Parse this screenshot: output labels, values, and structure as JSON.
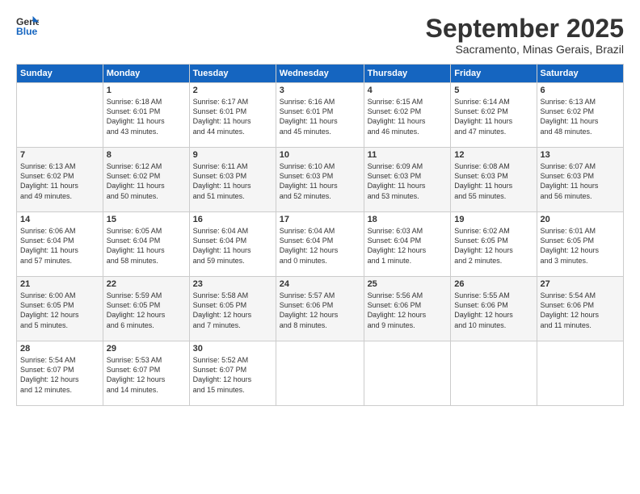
{
  "header": {
    "logo_line1": "General",
    "logo_line2": "Blue",
    "month": "September 2025",
    "location": "Sacramento, Minas Gerais, Brazil"
  },
  "days_of_week": [
    "Sunday",
    "Monday",
    "Tuesday",
    "Wednesday",
    "Thursday",
    "Friday",
    "Saturday"
  ],
  "weeks": [
    [
      {
        "num": "",
        "info": ""
      },
      {
        "num": "1",
        "info": "Sunrise: 6:18 AM\nSunset: 6:01 PM\nDaylight: 11 hours\nand 43 minutes."
      },
      {
        "num": "2",
        "info": "Sunrise: 6:17 AM\nSunset: 6:01 PM\nDaylight: 11 hours\nand 44 minutes."
      },
      {
        "num": "3",
        "info": "Sunrise: 6:16 AM\nSunset: 6:01 PM\nDaylight: 11 hours\nand 45 minutes."
      },
      {
        "num": "4",
        "info": "Sunrise: 6:15 AM\nSunset: 6:02 PM\nDaylight: 11 hours\nand 46 minutes."
      },
      {
        "num": "5",
        "info": "Sunrise: 6:14 AM\nSunset: 6:02 PM\nDaylight: 11 hours\nand 47 minutes."
      },
      {
        "num": "6",
        "info": "Sunrise: 6:13 AM\nSunset: 6:02 PM\nDaylight: 11 hours\nand 48 minutes."
      }
    ],
    [
      {
        "num": "7",
        "info": "Sunrise: 6:13 AM\nSunset: 6:02 PM\nDaylight: 11 hours\nand 49 minutes."
      },
      {
        "num": "8",
        "info": "Sunrise: 6:12 AM\nSunset: 6:02 PM\nDaylight: 11 hours\nand 50 minutes."
      },
      {
        "num": "9",
        "info": "Sunrise: 6:11 AM\nSunset: 6:03 PM\nDaylight: 11 hours\nand 51 minutes."
      },
      {
        "num": "10",
        "info": "Sunrise: 6:10 AM\nSunset: 6:03 PM\nDaylight: 11 hours\nand 52 minutes."
      },
      {
        "num": "11",
        "info": "Sunrise: 6:09 AM\nSunset: 6:03 PM\nDaylight: 11 hours\nand 53 minutes."
      },
      {
        "num": "12",
        "info": "Sunrise: 6:08 AM\nSunset: 6:03 PM\nDaylight: 11 hours\nand 55 minutes."
      },
      {
        "num": "13",
        "info": "Sunrise: 6:07 AM\nSunset: 6:03 PM\nDaylight: 11 hours\nand 56 minutes."
      }
    ],
    [
      {
        "num": "14",
        "info": "Sunrise: 6:06 AM\nSunset: 6:04 PM\nDaylight: 11 hours\nand 57 minutes."
      },
      {
        "num": "15",
        "info": "Sunrise: 6:05 AM\nSunset: 6:04 PM\nDaylight: 11 hours\nand 58 minutes."
      },
      {
        "num": "16",
        "info": "Sunrise: 6:04 AM\nSunset: 6:04 PM\nDaylight: 11 hours\nand 59 minutes."
      },
      {
        "num": "17",
        "info": "Sunrise: 6:04 AM\nSunset: 6:04 PM\nDaylight: 12 hours\nand 0 minutes."
      },
      {
        "num": "18",
        "info": "Sunrise: 6:03 AM\nSunset: 6:04 PM\nDaylight: 12 hours\nand 1 minute."
      },
      {
        "num": "19",
        "info": "Sunrise: 6:02 AM\nSunset: 6:05 PM\nDaylight: 12 hours\nand 2 minutes."
      },
      {
        "num": "20",
        "info": "Sunrise: 6:01 AM\nSunset: 6:05 PM\nDaylight: 12 hours\nand 3 minutes."
      }
    ],
    [
      {
        "num": "21",
        "info": "Sunrise: 6:00 AM\nSunset: 6:05 PM\nDaylight: 12 hours\nand 5 minutes."
      },
      {
        "num": "22",
        "info": "Sunrise: 5:59 AM\nSunset: 6:05 PM\nDaylight: 12 hours\nand 6 minutes."
      },
      {
        "num": "23",
        "info": "Sunrise: 5:58 AM\nSunset: 6:05 PM\nDaylight: 12 hours\nand 7 minutes."
      },
      {
        "num": "24",
        "info": "Sunrise: 5:57 AM\nSunset: 6:06 PM\nDaylight: 12 hours\nand 8 minutes."
      },
      {
        "num": "25",
        "info": "Sunrise: 5:56 AM\nSunset: 6:06 PM\nDaylight: 12 hours\nand 9 minutes."
      },
      {
        "num": "26",
        "info": "Sunrise: 5:55 AM\nSunset: 6:06 PM\nDaylight: 12 hours\nand 10 minutes."
      },
      {
        "num": "27",
        "info": "Sunrise: 5:54 AM\nSunset: 6:06 PM\nDaylight: 12 hours\nand 11 minutes."
      }
    ],
    [
      {
        "num": "28",
        "info": "Sunrise: 5:54 AM\nSunset: 6:07 PM\nDaylight: 12 hours\nand 12 minutes."
      },
      {
        "num": "29",
        "info": "Sunrise: 5:53 AM\nSunset: 6:07 PM\nDaylight: 12 hours\nand 14 minutes."
      },
      {
        "num": "30",
        "info": "Sunrise: 5:52 AM\nSunset: 6:07 PM\nDaylight: 12 hours\nand 15 minutes."
      },
      {
        "num": "",
        "info": ""
      },
      {
        "num": "",
        "info": ""
      },
      {
        "num": "",
        "info": ""
      },
      {
        "num": "",
        "info": ""
      }
    ]
  ]
}
